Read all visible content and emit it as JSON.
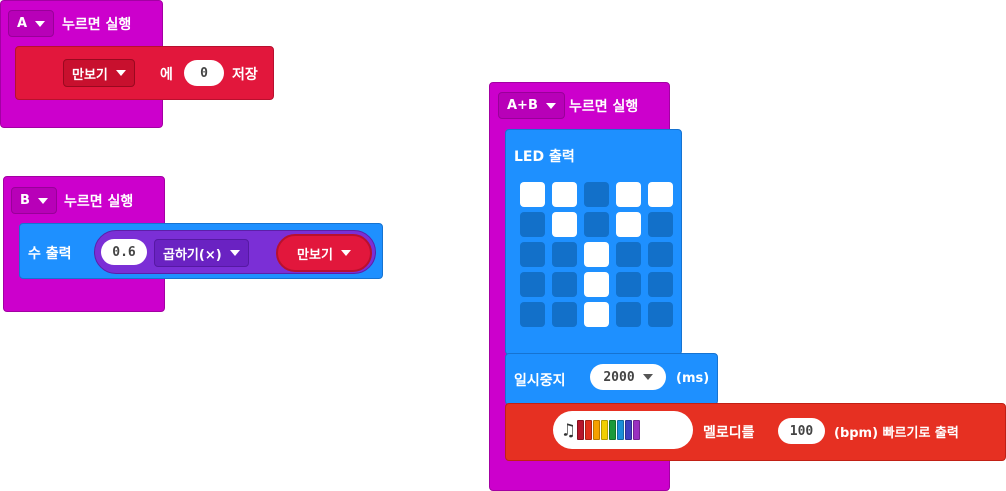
{
  "block_a": {
    "button": "A",
    "event_label": "누르면 실행",
    "dropdown": "만보기",
    "mid_text": "에",
    "value": "0",
    "action": "저장"
  },
  "block_b": {
    "button": "B",
    "event_label": "누르면 실행",
    "show_label": "수 출력",
    "value": "0.6",
    "operator": "곱하기(×)",
    "variable": "만보기"
  },
  "block_ab": {
    "button": "A+B",
    "event_label": "누르면 실행",
    "led_label": "LED 출력",
    "led_grid": [
      [
        1,
        1,
        0,
        1,
        1
      ],
      [
        0,
        1,
        0,
        1,
        0
      ],
      [
        0,
        0,
        1,
        0,
        0
      ],
      [
        0,
        0,
        1,
        0,
        0
      ],
      [
        0,
        0,
        1,
        0,
        0
      ]
    ],
    "pause_label": "일시중지",
    "pause_value": "2000",
    "pause_unit": "(ms)",
    "melody_label": "멜로디를",
    "tempo_value": "100",
    "tempo_unit": "(bpm) 빠르기로 출력",
    "melody_colors": [
      "#b5162a",
      "#e2301a",
      "#f5a000",
      "#f0d000",
      "#1b9a3a",
      "#1a8fd9",
      "#3f3fc0",
      "#9a2fc0"
    ]
  },
  "colors": {
    "event": "#cc00cc",
    "variables": "#e2173c",
    "basic": "#1e90ff",
    "math": "#7b2fd6",
    "music": "#e63022"
  }
}
